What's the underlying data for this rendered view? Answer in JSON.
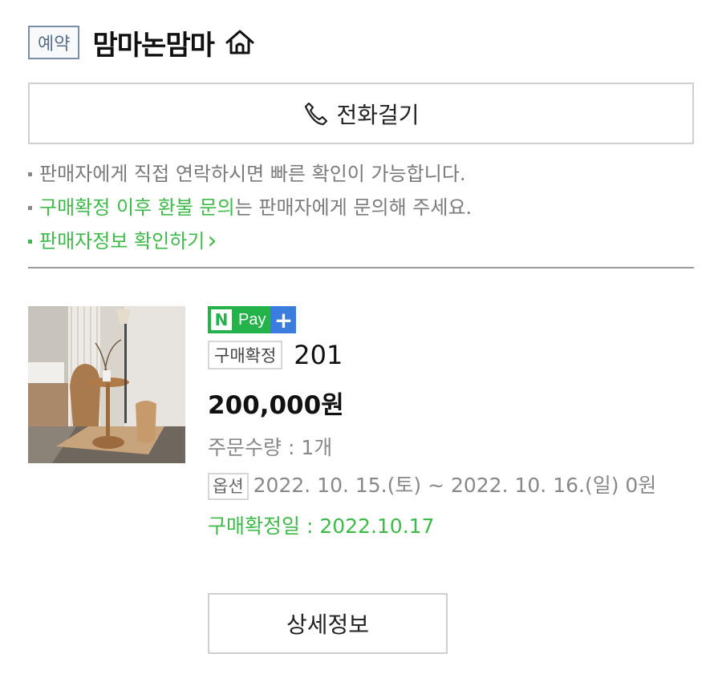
{
  "header": {
    "badge": "예약",
    "store_name": "맘마논맘마",
    "home_icon": "home-icon"
  },
  "call_button": {
    "icon": "phone-icon",
    "label": "전화걸기"
  },
  "notes": {
    "line1": "판매자에게 직접 연락하시면 빠른 확인이 가능합니다.",
    "line2_highlight": "구매확정 이후 환불 문의",
    "line2_rest": "는 판매자에게 문의해 주세요.",
    "seller_link": "판매자정보 확인하기",
    "seller_link_arrow": "›"
  },
  "colors": {
    "accent_green": "#3fba4a",
    "npay_green": "#24b24a",
    "npay_blue": "#3b7ddd",
    "badge_blue": "#5a6f8c"
  },
  "product": {
    "npay_n": "N",
    "npay_text": "Pay",
    "npay_plus": "+",
    "status": "구매확정",
    "name": "201",
    "price": "200,000원",
    "quantity": "주문수량 : 1개",
    "option_badge": "옵션",
    "option_text": "2022. 10. 15.(토) ~ 2022. 10. 16.(일) 0원",
    "confirm_date": "구매확정일 : 2022.10.17",
    "detail_button": "상세정보"
  }
}
